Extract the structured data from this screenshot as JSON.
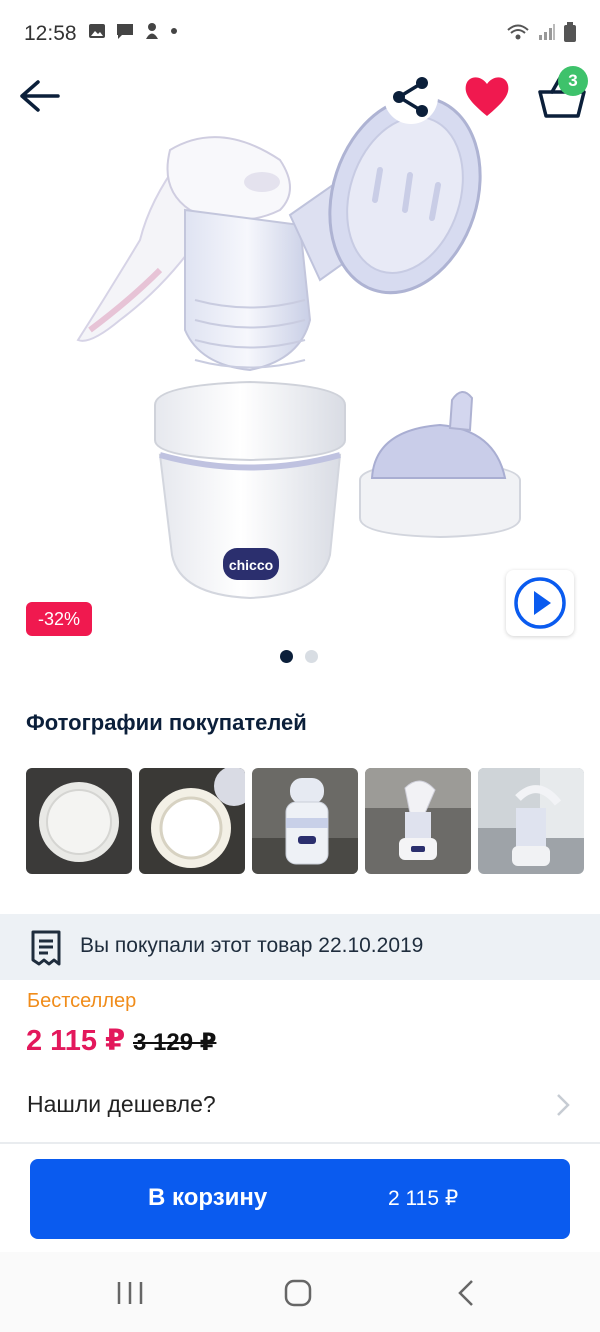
{
  "status_bar": {
    "time": "12:58"
  },
  "header": {
    "cart_count": "3"
  },
  "hero": {
    "discount": "-32%",
    "active_slide": 1,
    "slide_count": 2,
    "brand_logo_text": "chicco"
  },
  "photos": {
    "title": "Фотографии покупателей",
    "count": 5
  },
  "purchase_info": {
    "text": "Вы покупали этот товар 22.10.2019"
  },
  "price": {
    "badge": "Бестселлер",
    "current": "2 115 ₽",
    "old": "3 129 ₽"
  },
  "cheaper": {
    "label": "Нашли дешевле?"
  },
  "cart_button": {
    "label": "В корзину",
    "price": "2 115 ₽"
  },
  "colors": {
    "accent": "#0a5bef",
    "price": "#e3185c",
    "discount": "#f0194f",
    "bestseller": "#f08c1a",
    "badge": "#3ec26b"
  }
}
